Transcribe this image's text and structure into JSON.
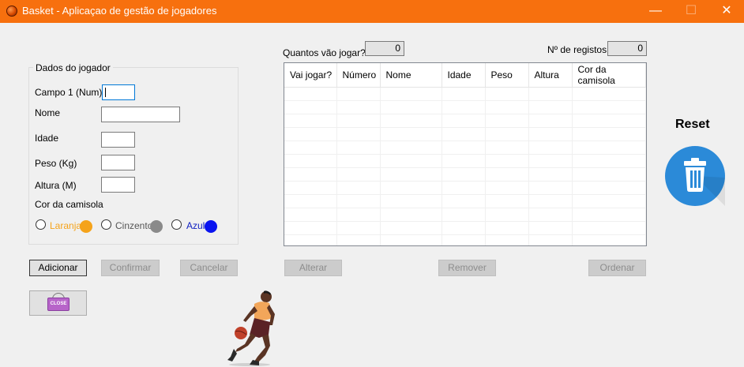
{
  "window": {
    "title": "Basket - Aplicaçao de gestão de jogadores",
    "minimize_glyph": "—",
    "maximize_glyph": "☐",
    "close_glyph": "✕"
  },
  "form": {
    "group_title": "Dados do jogador",
    "campo1_label": "Campo 1 (Num)",
    "nome_label": "Nome",
    "idade_label": "Idade",
    "peso_label": "Peso (Kg)",
    "altura_label": "Altura (M)",
    "cor_label": "Cor da camisola",
    "campo1_value": "",
    "nome_value": "",
    "idade_value": "",
    "peso_value": "",
    "altura_value": "",
    "colors": [
      {
        "label": "Laranja",
        "swatch": "#f5a31a",
        "text_color": "#f5a31a"
      },
      {
        "label": "Cinzento",
        "swatch": "#8a8a8a",
        "text_color": "#555555"
      },
      {
        "label": "Azul",
        "swatch": "#0a14f0",
        "text_color": "#1020c0"
      }
    ]
  },
  "info": {
    "quantos_label": "Quantos vão jogar?",
    "quantos_value": "0",
    "registos_label": "Nº de registos",
    "registos_value": "0"
  },
  "grid": {
    "columns": [
      "Vai jogar?",
      "Número",
      "Nome",
      "Idade",
      "Peso",
      "Altura",
      "Cor da camisola"
    ],
    "rows": []
  },
  "buttons": {
    "adicionar": "Adicionar",
    "confirmar": "Confirmar",
    "cancelar": "Cancelar",
    "alterar": "Alterar",
    "remover": "Remover",
    "ordenar": "Ordenar",
    "close_sign_text": "CLOSE"
  },
  "reset": {
    "label": "Reset",
    "icon": "trash-icon",
    "color": "#2b8ad8"
  }
}
